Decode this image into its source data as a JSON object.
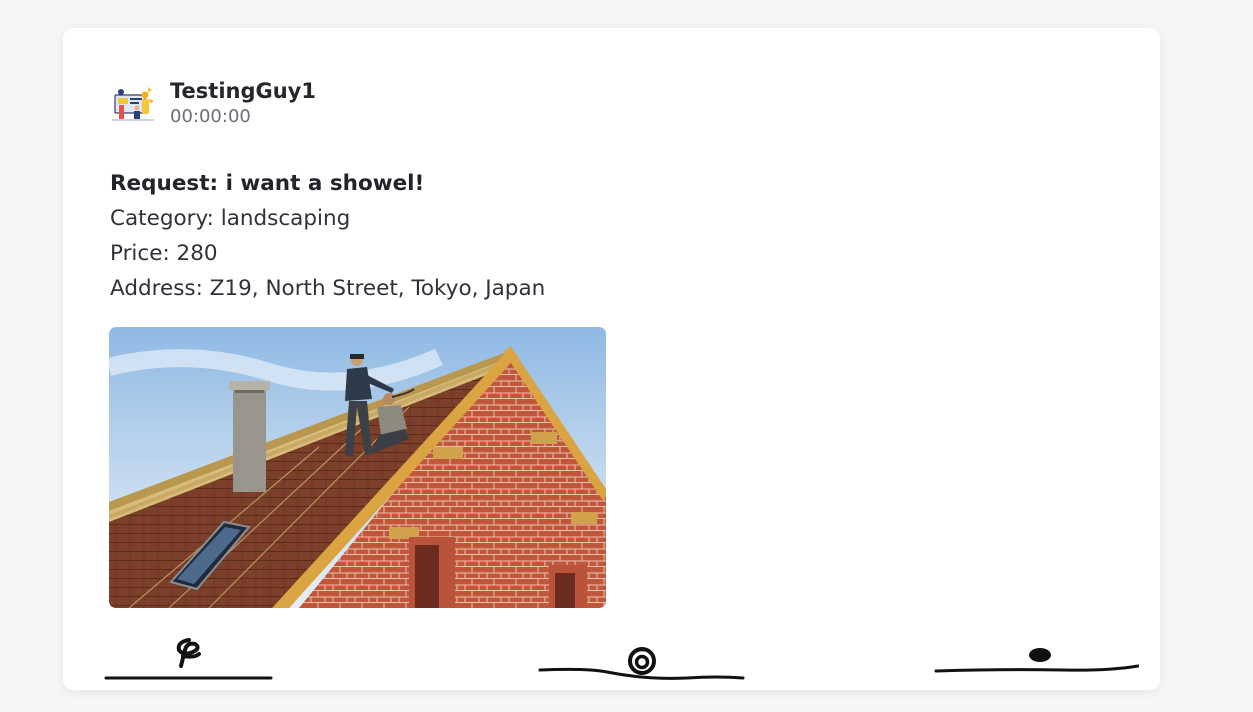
{
  "post": {
    "author": {
      "name": "TestingGuy1",
      "timestamp": "00:00:00",
      "avatar_icon": "team-illustration-avatar"
    },
    "request_title": "Request: i want a showel!",
    "category": "Category: landscaping",
    "price": "Price: 280",
    "address": "Address: Z19, North Street, Tokyo, Japan",
    "image": {
      "subject": "roofers-installing-roof-photo"
    }
  },
  "actions": [
    {
      "icon": "hand-drawn-scribble-icon"
    },
    {
      "icon": "hand-drawn-spiral-icon"
    },
    {
      "icon": "hand-drawn-dot-icon"
    }
  ],
  "colors": {
    "page_background": "#f5f5f6",
    "card_background": "#ffffff",
    "text_primary": "#25272d",
    "text_secondary": "#6d7078",
    "ink": "#111111"
  }
}
